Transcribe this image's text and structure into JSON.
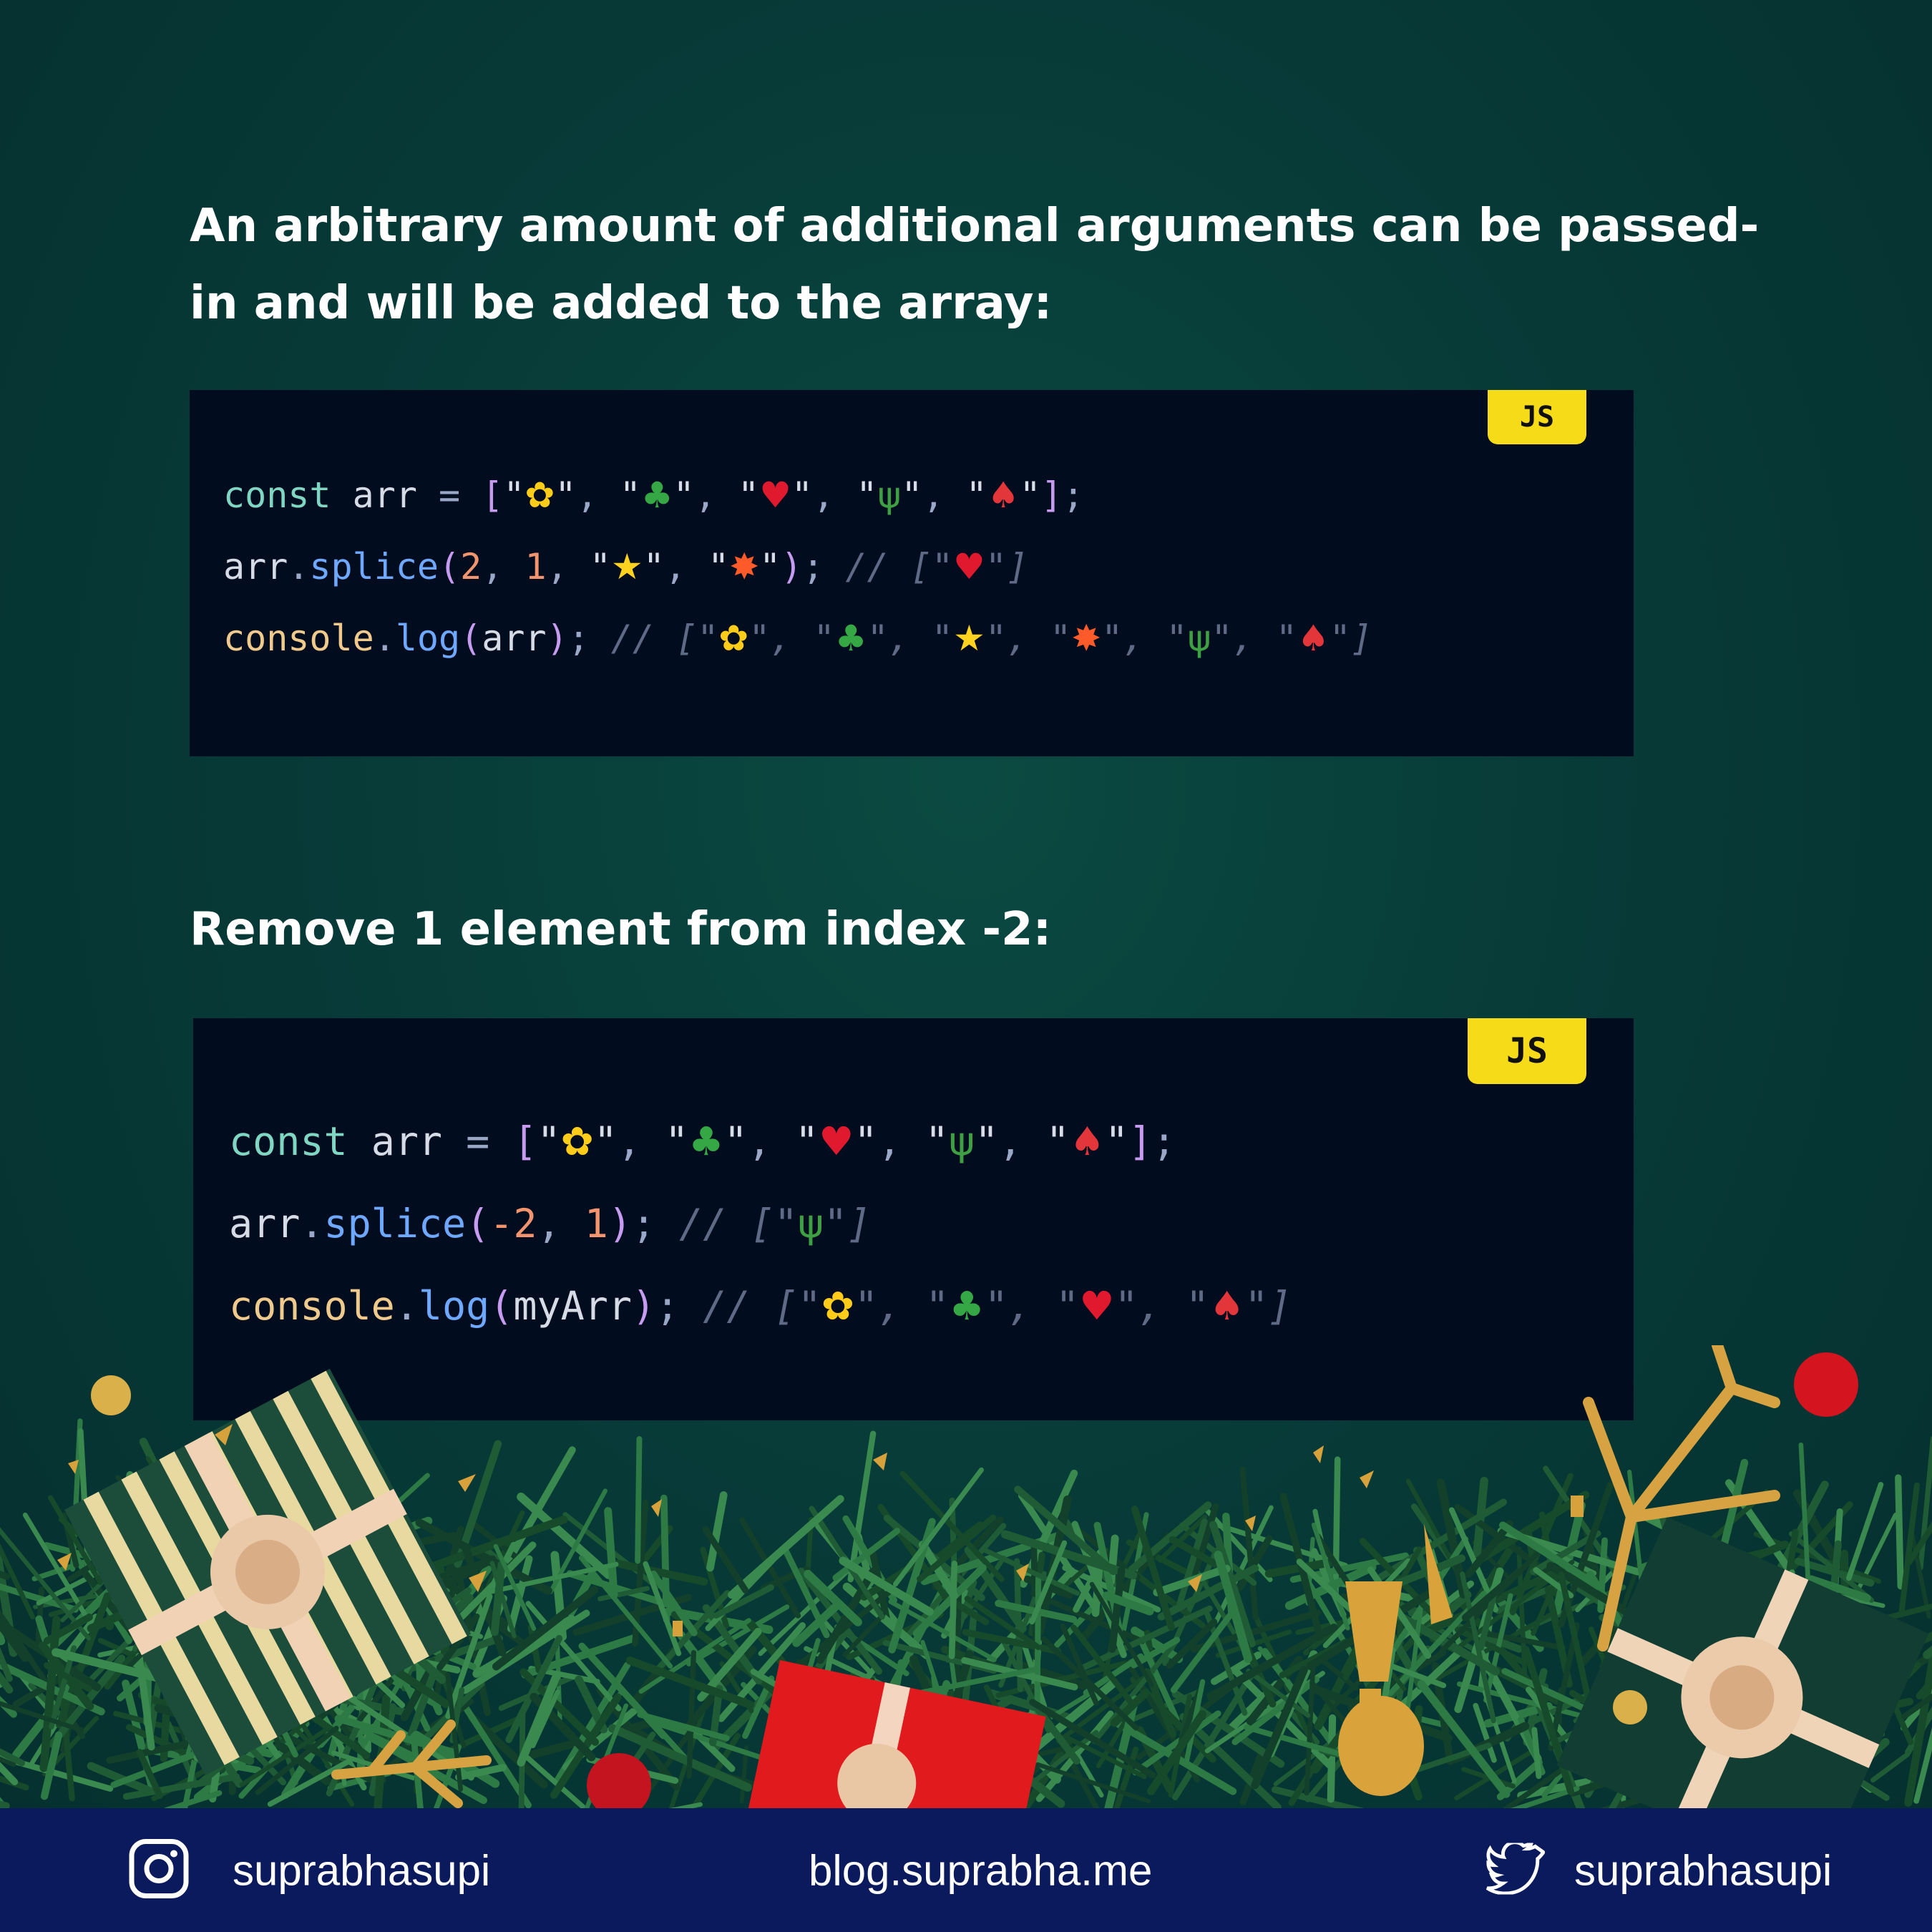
{
  "headings": {
    "first_line1": "An arbitrary amount of additional arguments can be passed-",
    "first_line2": "in and will be added to the array:",
    "second": "Remove 1 element from index -2:"
  },
  "code_blocks": [
    {
      "badge": "JS",
      "lines": [
        "const arr = [\"🌼\", \"🌴\", \"🌹\", \"🌵\", \"🍄\"];",
        "arr.splice(2, 1, \"⭐\", \"💥\"); // [\"🌹\"]",
        "console.log(arr); // [\"🌼\", \"🌴\", \"⭐\", \"💥\", \"🌵\", \"🍄\"]"
      ]
    },
    {
      "badge": "JS",
      "lines": [
        "const arr = [\"🌼\", \"🌴\", \"🌹\", \"🌵\", \"🍄\"];",
        "arr.splice(-2, 1); // [\"🌵\"]",
        "console.log(myArr); // [\"🌼\", \"🌴\", \"🌹\", \"🍄\"]"
      ]
    }
  ],
  "footer": {
    "instagram": "suprabhasupi",
    "blog": "blog.suprabha.me",
    "twitter": "suprabhasupi",
    "icons": [
      "instagram-icon",
      "twitter-icon"
    ]
  },
  "colors": {
    "background": "#073b38",
    "code_bg": "#010d1f",
    "badge": "#f6dc18",
    "footer": "#0a1a5c"
  }
}
